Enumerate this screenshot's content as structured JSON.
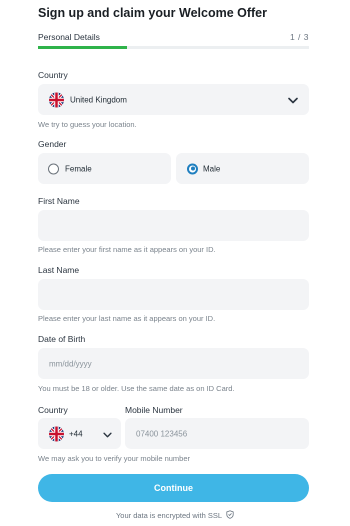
{
  "header": {
    "title": "Sign up and claim your Welcome Offer",
    "step_label": "Personal Details",
    "step_count": "1 / 3",
    "progress": 0.33
  },
  "country": {
    "label": "Country",
    "value": "United Kingdom",
    "flag_icon": "uk-flag-icon",
    "hint": "We try to guess your location."
  },
  "gender": {
    "label": "Gender",
    "options": [
      {
        "label": "Female",
        "selected": false
      },
      {
        "label": "Male",
        "selected": true
      }
    ]
  },
  "first_name": {
    "label": "First Name",
    "value": "",
    "hint": "Please enter your first name as it appears on your ID."
  },
  "last_name": {
    "label": "Last Name",
    "value": "",
    "hint": "Please enter your last name as it appears on your ID."
  },
  "dob": {
    "label": "Date of Birth",
    "placeholder": "mm/dd/yyyy",
    "hint": "You must be 18 or older. Use the same date as on ID Card."
  },
  "phone": {
    "country_label": "Country",
    "dial_code": "+44",
    "number_label": "Mobile Number",
    "placeholder": "07400 123456",
    "hint": "We may ask you to verify your mobile number"
  },
  "actions": {
    "continue_label": "Continue"
  },
  "footer": {
    "ssl_text": "Your data is encrypted with SSL"
  },
  "colors": {
    "accent": "#3fb6e6",
    "progress": "#2fb34a",
    "radio": "#1f7fbf"
  }
}
